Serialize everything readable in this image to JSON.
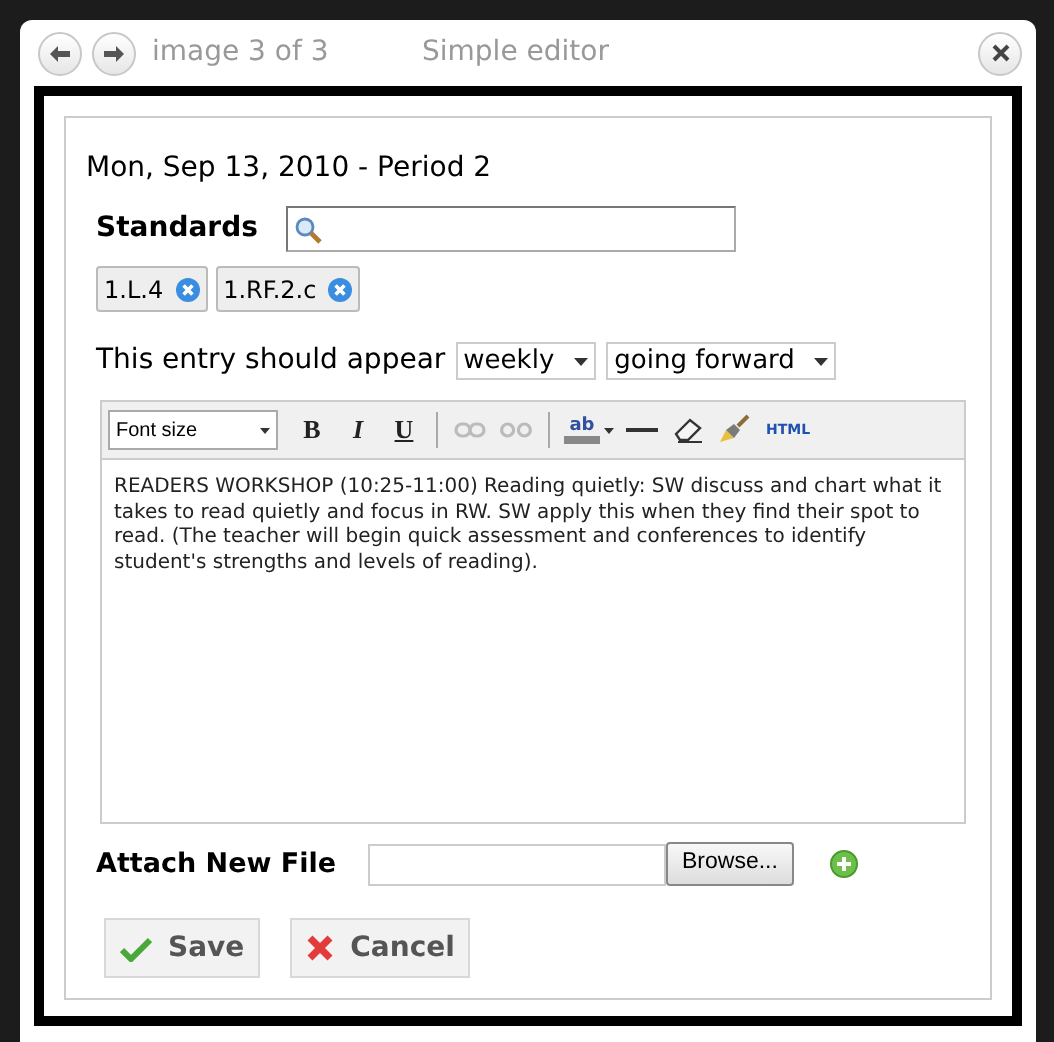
{
  "dialog": {
    "counter": "image 3 of 3",
    "title": "Simple editor"
  },
  "entry": {
    "heading": "Mon, Sep 13, 2010 - Period 2",
    "standards": {
      "label": "Standards",
      "tags": [
        "1.L.4",
        "1.RF.2.c"
      ]
    },
    "schedule": {
      "label": "This entry should appear",
      "frequency": "weekly",
      "duration": "going forward"
    },
    "editor": {
      "font_size": "Font size",
      "toolbar": [
        {
          "kind": "bold",
          "label": "B",
          "disabled": false
        },
        {
          "kind": "italic",
          "label": "I",
          "disabled": false
        },
        {
          "kind": "underline",
          "label": "U",
          "disabled": false
        },
        {
          "kind": "separator"
        },
        {
          "kind": "link",
          "disabled": true
        },
        {
          "kind": "unlink",
          "disabled": true
        },
        {
          "kind": "separator"
        },
        {
          "kind": "highlight",
          "label": "ab",
          "disabled": false
        },
        {
          "kind": "rule",
          "disabled": false
        },
        {
          "kind": "eraser",
          "disabled": false
        },
        {
          "kind": "brush",
          "disabled": false
        },
        {
          "kind": "html",
          "label": "HTML",
          "disabled": false
        }
      ],
      "content": "READERS WORKSHOP (10:25-11:00) Reading quietly: SW discuss and chart what it takes to read quietly and focus in RW.  SW apply this when they find their spot to read.  (The teacher will begin quick assessment and conferences to identify student's strengths and levels of reading)."
    },
    "attach": {
      "label": "Attach New File",
      "browse": "Browse..."
    },
    "buttons": [
      {
        "kind": "save",
        "label": "Save"
      },
      {
        "kind": "cancel",
        "label": "Cancel"
      }
    ]
  }
}
